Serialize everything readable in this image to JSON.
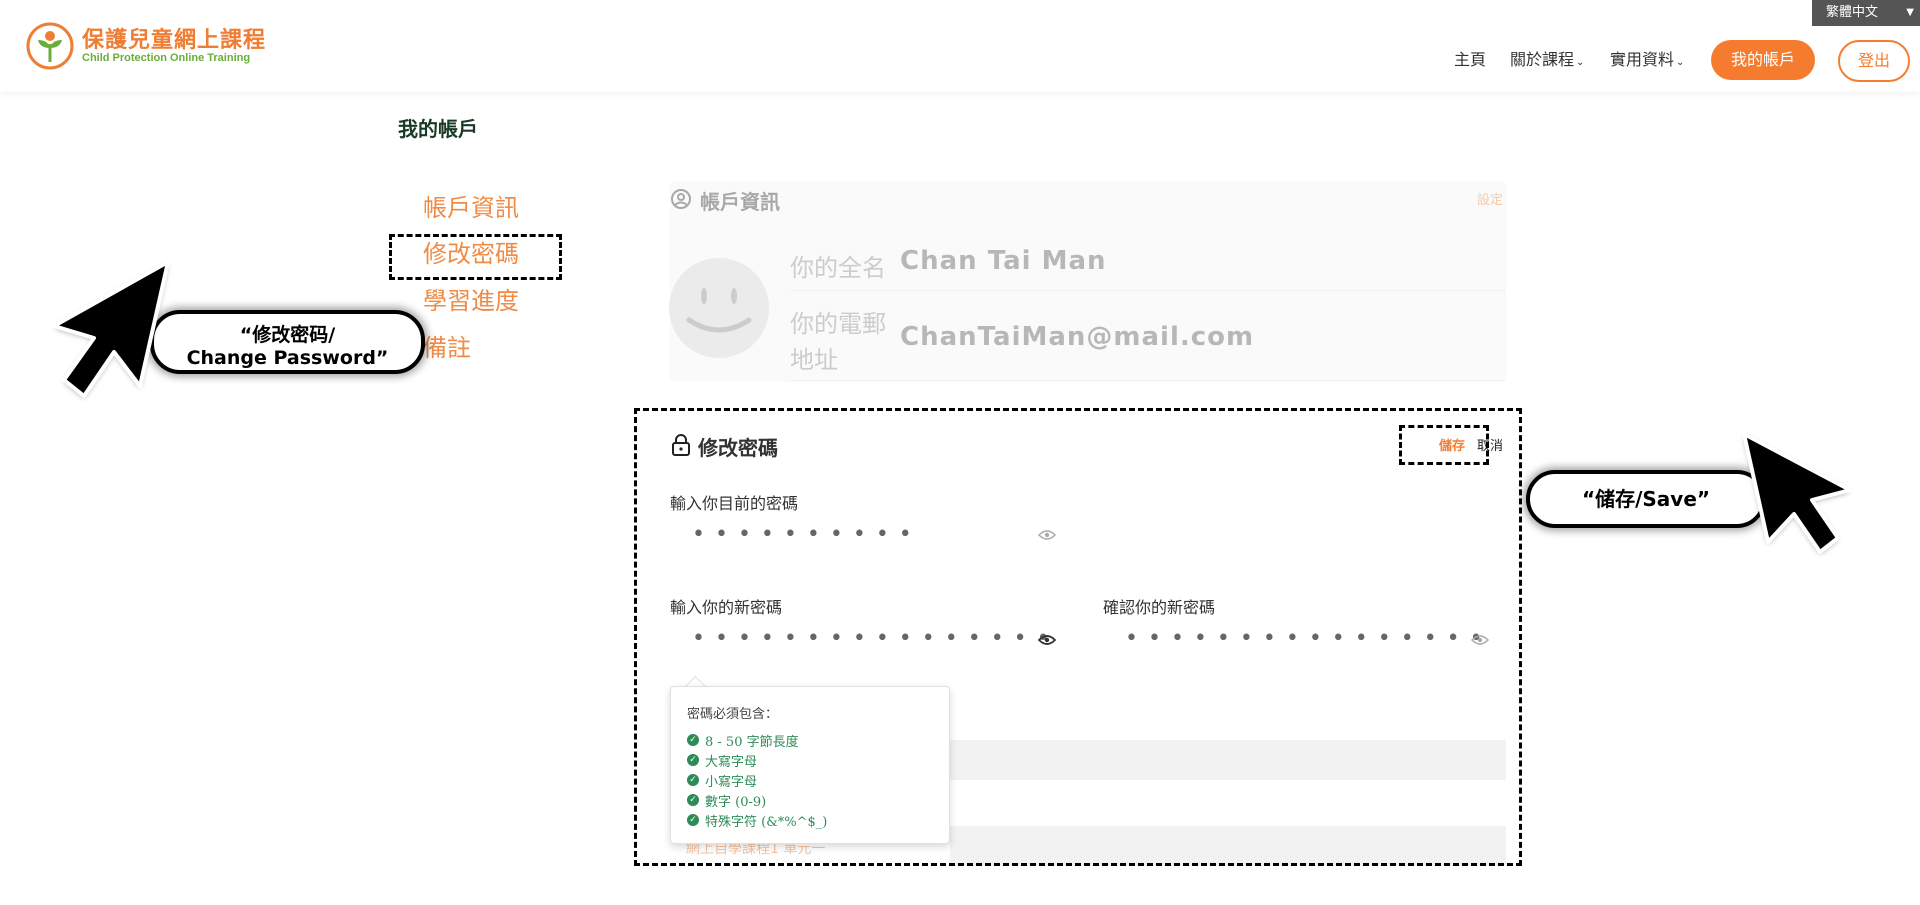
{
  "header": {
    "logo_title": "保護兒童網上課程",
    "logo_subtitle": "Child Protection Online Training",
    "language": "繁體中文",
    "nav": [
      "主頁",
      "關於課程",
      "實用資料"
    ],
    "my_account_button": "我的帳戶",
    "logout_button": "登出"
  },
  "page": {
    "title": "我的帳戶",
    "sidebar": [
      "帳戶資訊",
      "修改密碼",
      "學習進度",
      "備註"
    ]
  },
  "account_info": {
    "heading": "帳戶資訊",
    "settings_link": "設定",
    "name_label": "你的全名",
    "name_value": "Chan Tai Man",
    "email_label_line1": "你的電郵",
    "email_label_line2": "地址",
    "email_value": "ChanTaiMan@mail.com"
  },
  "change_password": {
    "heading": "修改密碼",
    "save_link": "儲存",
    "cancel_link": "取消",
    "current_label": "輸入你目前的密碼",
    "current_value": "••••••••••",
    "new_label": "輸入你的新密碼",
    "new_value": "••••••••••••••••",
    "confirm_label": "確認你的新密碼",
    "confirm_value": "••••••••••••••••",
    "tooltip_title": "密碼必須包含：",
    "requirements": [
      "8 - 50 字節長度",
      "大寫字母",
      "小寫字母",
      "數字 (0-9)",
      "特殊字符 (&*%^$_)"
    ],
    "faded_text": "網上自學課程1 單元一"
  },
  "annotations": {
    "left_callout_line1": "“修改密码/",
    "left_callout_line2": "Change Password”",
    "right_callout": "“储存/Save”"
  },
  "colors": {
    "brand_orange": "#f57c2e",
    "brand_green": "#6aae3a",
    "check_green": "#2e8b57"
  }
}
